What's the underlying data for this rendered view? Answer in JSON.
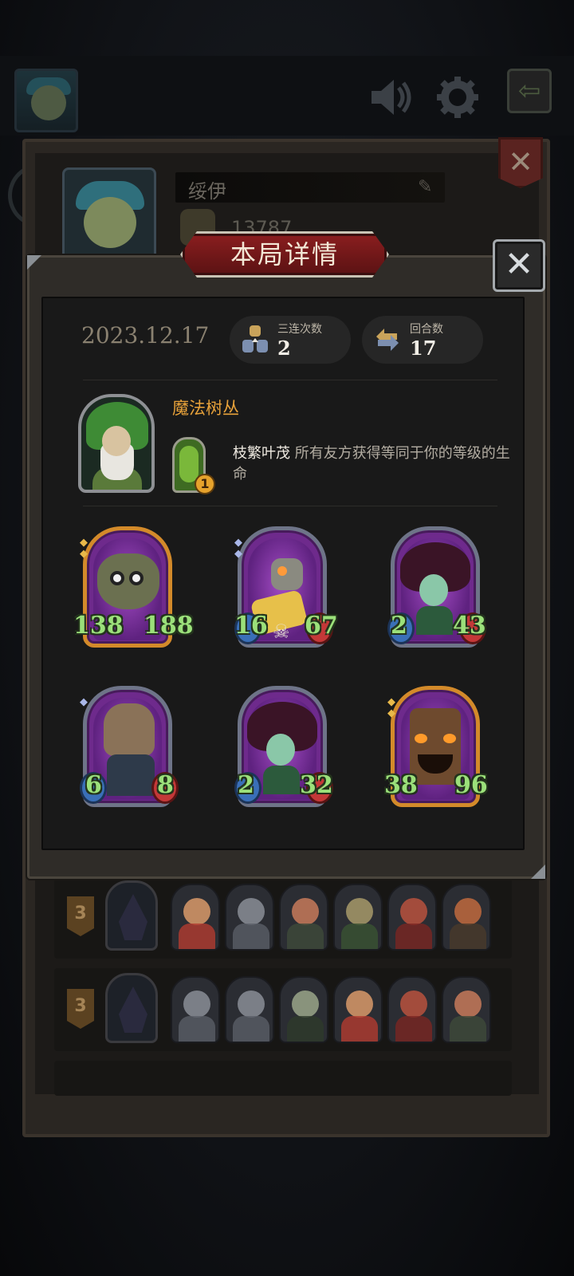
{
  "background": {
    "player_name": "绥伊",
    "player_score": "13787",
    "rounds": [
      {
        "rank": "3"
      },
      {
        "rank": "3"
      }
    ]
  },
  "modal": {
    "title": "本局详情",
    "date": "2023.12.17",
    "stats": {
      "triples_label": "三连次数",
      "triples_value": "2",
      "rounds_label": "回合数",
      "rounds_value": "17"
    },
    "hero": {
      "name": "魔法树丛",
      "skill_level": "1",
      "skill_name": "枝繁叶茂",
      "skill_text": "所有友方获得等同于你的等级的生命"
    },
    "units": [
      {
        "attack": "138",
        "health": "188"
      },
      {
        "attack": "16",
        "health": "67"
      },
      {
        "attack": "2",
        "health": "43"
      },
      {
        "attack": "6",
        "health": "8"
      },
      {
        "attack": "2",
        "health": "32"
      },
      {
        "attack": "38",
        "health": "96"
      }
    ]
  },
  "icons": {
    "close": "close-icon",
    "speaker": "speaker-icon",
    "settings": "gear-icon",
    "back": "back-arrow-icon",
    "edit": "pencil-icon"
  },
  "colors": {
    "title_banner": "#8b1e1f",
    "hero_name": "#e8a23a",
    "stat_number": "#9be07a",
    "gold_frame": "#d38a2a",
    "silver_frame": "#6e7488"
  }
}
